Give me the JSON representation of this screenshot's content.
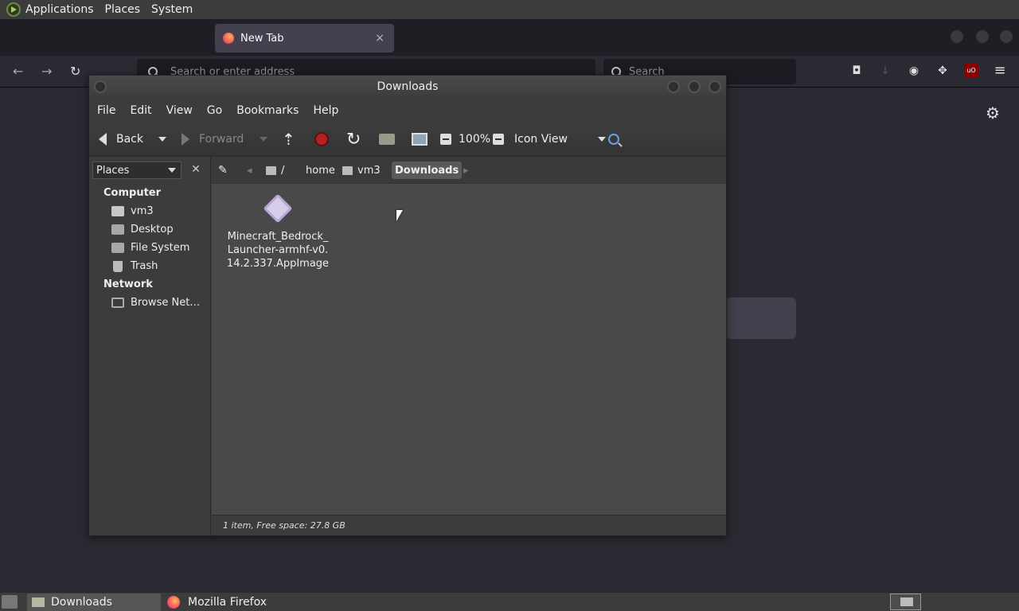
{
  "system_panel": {
    "menus": [
      "Applications",
      "Places",
      "System"
    ]
  },
  "firefox": {
    "tabs": [
      {
        "label": ""
      },
      {
        "label": "New Tab"
      }
    ],
    "tab_close": "×",
    "url_placeholder": "Search or enter address",
    "search_placeholder": "Search",
    "nav": {
      "back": "←",
      "forward": "→",
      "reload": "↻"
    },
    "icons": [
      "pocket-icon",
      "download-icon",
      "account-icon",
      "extensions-icon",
      "ublock-icon",
      "menu-icon"
    ],
    "ublock_label": "uO",
    "menu_glyph": "≡",
    "gear_glyph": "⚙"
  },
  "caja": {
    "title": "Downloads",
    "menubar": [
      "File",
      "Edit",
      "View",
      "Go",
      "Bookmarks",
      "Help"
    ],
    "toolbar": {
      "back": "Back",
      "forward": "Forward",
      "zoom": "100%",
      "view_mode": "Icon View"
    },
    "sidebar": {
      "selector": "Places",
      "close": "✕",
      "sections": [
        {
          "heading": "Computer",
          "items": [
            {
              "label": "vm3",
              "icon": "home-folder-icon"
            },
            {
              "label": "Desktop",
              "icon": "desktop-folder-icon"
            },
            {
              "label": "File System",
              "icon": "drive-icon"
            },
            {
              "label": "Trash",
              "icon": "trash-icon"
            }
          ]
        },
        {
          "heading": "Network",
          "items": [
            {
              "label": "Browse Net…",
              "icon": "network-icon"
            }
          ]
        }
      ]
    },
    "pathbar": {
      "root": "/",
      "crumbs": [
        "home",
        "vm3",
        "Downloads"
      ]
    },
    "files": [
      {
        "name": "Minecraft_Bedrock_\nLauncher-armhf-v0.\n14.2.337.AppImage",
        "icon": "appimage-icon"
      }
    ],
    "status": "1 item, Free space: 27.8 GB"
  },
  "taskbar": {
    "tasks": [
      "Downloads",
      "Mozilla Firefox"
    ]
  }
}
